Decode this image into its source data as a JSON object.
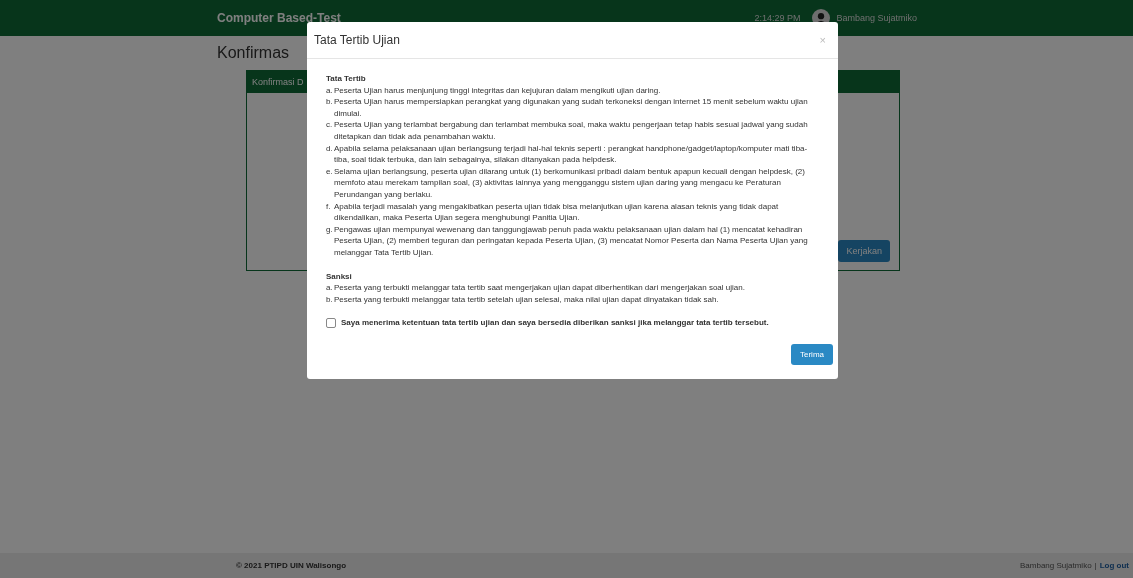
{
  "navbar": {
    "brand": "Computer Based-Test",
    "time": "2:14:29 PM",
    "user": "Bambang Sujatmiko"
  },
  "page": {
    "title": "Konfirmas",
    "panel_title": "Konfirmasi D",
    "button": "Kerjakan"
  },
  "footer": {
    "copyright": "© 2021 PTIPD UIN Walisongo",
    "user": "Bambang Sujatmiko",
    "separator": "|",
    "logout": "Log out"
  },
  "modal": {
    "title": "Tata Tertib Ujian",
    "close": "×",
    "sections": [
      {
        "title": "Tata Tertib",
        "items": [
          {
            "marker": "a.",
            "text": "Peserta Ujian harus menjunjung tinggi integritas dan kejujuran dalam mengikuti ujian daring."
          },
          {
            "marker": "b.",
            "text": "Peserta Ujian harus mempersiapkan perangkat yang digunakan yang sudah terkoneksi dengan internet 15 menit sebelum waktu ujian dimulai."
          },
          {
            "marker": "c.",
            "text": "Peserta Ujian yang terlambat bergabung dan terlambat membuka soal, maka waktu pengerjaan tetap habis sesuai jadwal yang sudah ditetapkan dan tidak ada penambahan waktu."
          },
          {
            "marker": "d.",
            "text": "Apabila selama pelaksanaan ujian berlangsung terjadi hal-hal teknis seperti : perangkat handphone/gadget/laptop/komputer mati tiba-tiba, soal tidak terbuka, dan lain sebagainya, silakan ditanyakan pada helpdesk."
          },
          {
            "marker": "e.",
            "text": "Selama ujian berlangsung, peserta ujian dilarang untuk (1) berkomunikasi pribadi dalam bentuk apapun kecuali dengan helpdesk, (2) memfoto atau merekam tampilan soal, (3) aktivitas lainnya yang mengganggu sistem ujian daring yang mengacu ke Peraturan Perundangan yang berlaku."
          },
          {
            "marker": "f.",
            "text": "Apabila terjadi masalah yang mengakibatkan peserta ujian tidak bisa melanjutkan ujian karena alasan teknis yang tidak dapat dikendalikan, maka Peserta Ujian segera menghubungi Panitia Ujian."
          },
          {
            "marker": "g.",
            "text": "Pengawas ujian mempunyai wewenang dan tanggungjawab penuh pada waktu pelaksanaan ujian dalam hal (1) mencatat kehadiran Peserta Ujian, (2) memberi teguran dan peringatan kepada Peserta Ujian, (3) mencatat Nomor Peserta dan Nama Peserta Ujian yang melanggar Tata Tertib Ujian."
          }
        ]
      },
      {
        "title": "Sanksi",
        "items": [
          {
            "marker": "a.",
            "text": "Peserta yang terbukti melanggar tata tertib saat mengerjakan ujian dapat diberhentikan dari mengerjakan soal ujian."
          },
          {
            "marker": "b.",
            "text": "Peserta yang terbukti melanggar tata tertib setelah ujian selesai, maka nilai ujian dapat dinyatakan tidak sah."
          }
        ]
      }
    ],
    "agreement": {
      "label": "Saya menerima ketentuan tata tertib ujian dan saya bersedia diberikan sanksi jika melanggar tata tertib tersebut.",
      "checked": false
    },
    "button": "Terima"
  }
}
